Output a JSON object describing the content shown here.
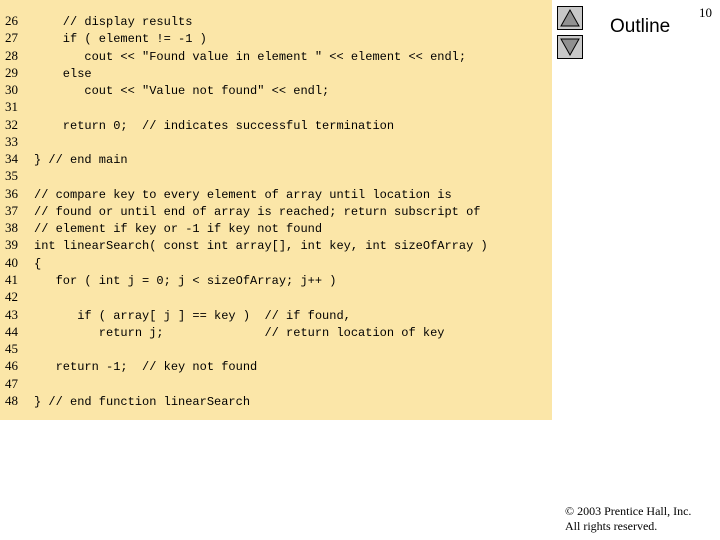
{
  "slide": {
    "page_number": "10",
    "outline_label": "Outline",
    "copyright_line1": "© 2003 Prentice Hall, Inc.",
    "copyright_line2": "All rights reserved.",
    "nav": {
      "up_icon": "triangle-up-icon",
      "down_icon": "triangle-down-icon"
    }
  },
  "code_lines": [
    {
      "num": "26",
      "text": "    // display results"
    },
    {
      "num": "27",
      "text": "    if ( element != -1 )"
    },
    {
      "num": "28",
      "text": "       cout << \"Found value in element \" << element << endl;"
    },
    {
      "num": "29",
      "text": "    else"
    },
    {
      "num": "30",
      "text": "       cout << \"Value not found\" << endl;"
    },
    {
      "num": "31",
      "text": ""
    },
    {
      "num": "32",
      "text": "    return 0;  // indicates successful termination"
    },
    {
      "num": "33",
      "text": ""
    },
    {
      "num": "34",
      "text": "} // end main"
    },
    {
      "num": "35",
      "text": ""
    },
    {
      "num": "36",
      "text": "// compare key to every element of array until location is"
    },
    {
      "num": "37",
      "text": "// found or until end of array is reached; return subscript of"
    },
    {
      "num": "38",
      "text": "// element if key or -1 if key not found"
    },
    {
      "num": "39",
      "text": "int linearSearch( const int array[], int key, int sizeOfArray )"
    },
    {
      "num": "40",
      "text": "{"
    },
    {
      "num": "41",
      "text": "   for ( int j = 0; j < sizeOfArray; j++ )"
    },
    {
      "num": "42",
      "text": ""
    },
    {
      "num": "43",
      "text": "      if ( array[ j ] == key )  // if found,"
    },
    {
      "num": "44",
      "text": "         return j;              // return location of key"
    },
    {
      "num": "45",
      "text": ""
    },
    {
      "num": "46",
      "text": "   return -1;  // key not found"
    },
    {
      "num": "47",
      "text": ""
    },
    {
      "num": "48",
      "text": "} // end function linearSearch"
    }
  ]
}
